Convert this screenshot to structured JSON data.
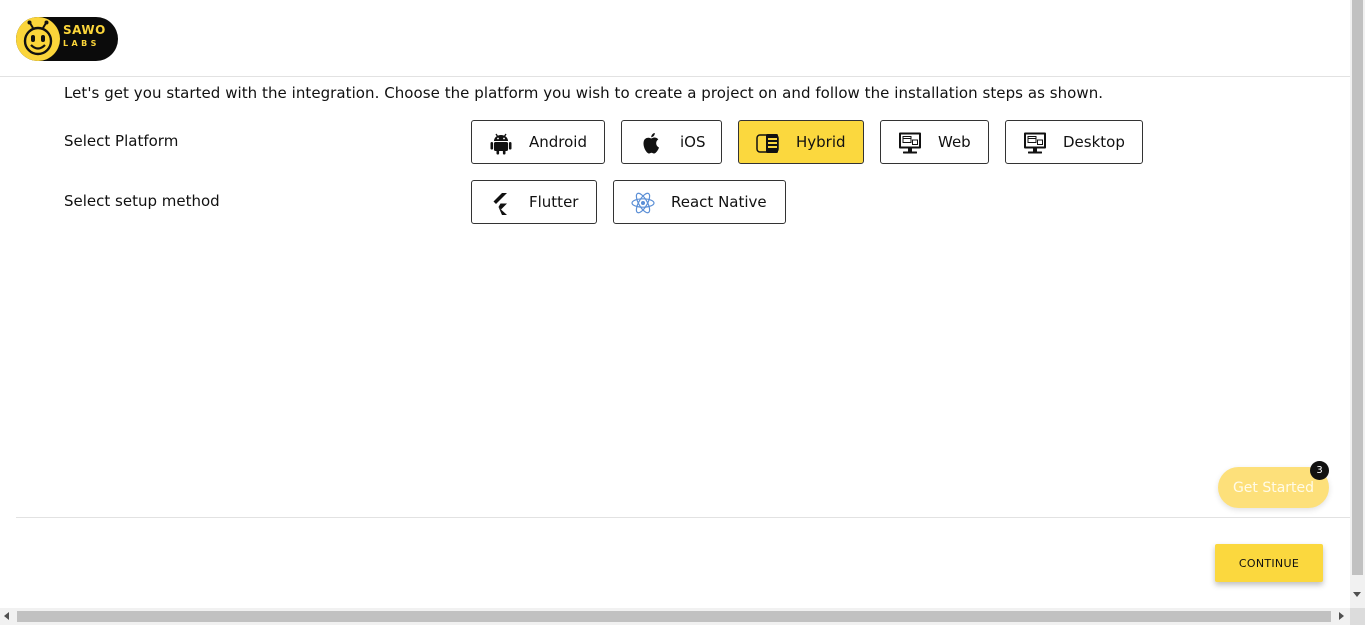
{
  "brand": {
    "name_line1": "SAWO",
    "name_line2": "LABS",
    "logo_icon": "bee-face-icon"
  },
  "intro_text": "Let's get you started with the integration. Choose the platform you wish to create a project on and follow the installation steps as shown.",
  "platform": {
    "label": "Select Platform",
    "selected": "Hybrid",
    "options": [
      {
        "label": "Android",
        "icon": "android-icon"
      },
      {
        "label": "iOS",
        "icon": "apple-icon"
      },
      {
        "label": "Hybrid",
        "icon": "hybrid-icon"
      },
      {
        "label": "Web",
        "icon": "monitor-icon"
      },
      {
        "label": "Desktop",
        "icon": "monitor-icon"
      }
    ]
  },
  "setup_method": {
    "label": "Select setup method",
    "options": [
      {
        "label": "Flutter",
        "icon": "flutter-icon"
      },
      {
        "label": "React Native",
        "icon": "react-icon"
      }
    ]
  },
  "floating": {
    "get_started_label": "Get Started",
    "badge_count": "3"
  },
  "footer": {
    "continue_label": "CONTINUE"
  },
  "colors": {
    "accent": "#fbd83e",
    "brand_dark": "#0b0b0b"
  }
}
